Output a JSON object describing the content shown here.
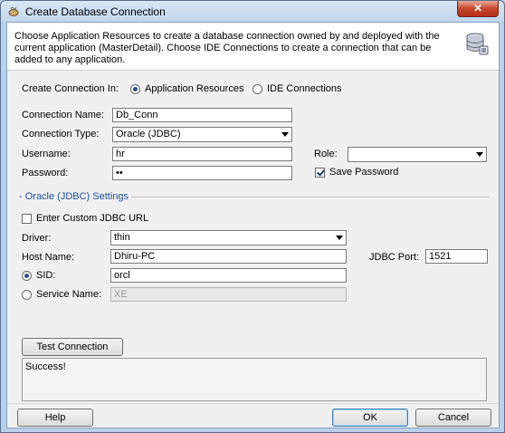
{
  "window": {
    "title": "Create Database Connection",
    "close_label": "✕"
  },
  "header": {
    "description": "Choose Application Resources to create a database connection owned by and deployed with the current application (MasterDetail). Choose IDE Connections to create a connection that can be added to any application."
  },
  "create_in": {
    "label": "Create Connection In:",
    "options": [
      "Application Resources",
      "IDE Connections"
    ],
    "selected": "Application Resources"
  },
  "form": {
    "connection_name_label": "Connection Name:",
    "connection_name_value": "Db_Conn",
    "connection_type_label": "Connection Type:",
    "connection_type_value": "Oracle (JDBC)",
    "username_label": "Username:",
    "username_value": "hr",
    "role_label": "Role:",
    "role_value": "",
    "password_label": "Password:",
    "password_value": "••",
    "save_password_label": "Save Password",
    "save_password_checked": true
  },
  "oracle_settings": {
    "section_title": "- Oracle (JDBC) Settings",
    "custom_url_label": "Enter Custom JDBC URL",
    "custom_url_checked": false,
    "driver_label": "Driver:",
    "driver_value": "thin",
    "host_label": "Host Name:",
    "host_value": "Dhiru-PC",
    "port_label": "JDBC Port:",
    "port_value": "1521",
    "sid_label": "SID:",
    "sid_value": "orcl",
    "service_label": "Service Name:",
    "service_value": "XE",
    "selected_mode": "SID"
  },
  "test": {
    "button_label": "Test Connection",
    "result_text": "Success!"
  },
  "footer": {
    "help_label": "Help",
    "ok_label": "OK",
    "cancel_label": "Cancel"
  }
}
